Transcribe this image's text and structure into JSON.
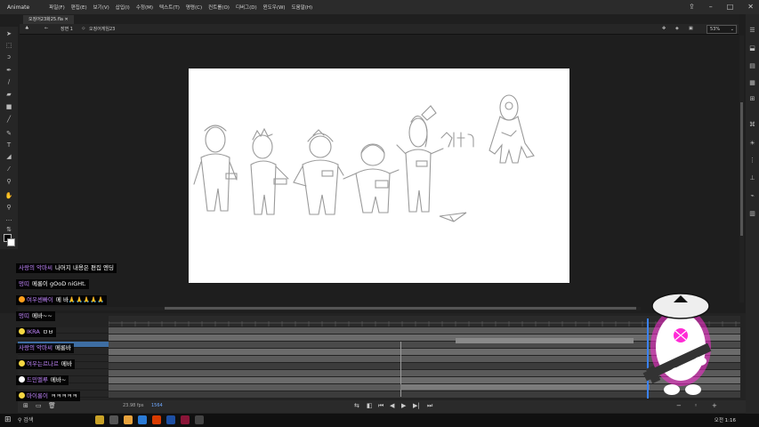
{
  "app": {
    "name": "Animate",
    "menus": [
      "파일(F)",
      "편집(E)",
      "보기(V)",
      "삽입(I)",
      "수정(M)",
      "텍스트(T)",
      "명령(C)",
      "컨트롤(O)",
      "디버그(D)",
      "윈도우(W)",
      "도움말(H)"
    ]
  },
  "document": {
    "tab_label": "오징어23화25.fla",
    "scene_label": "장면 1",
    "symbol_label": "오징어게임23",
    "zoom": "53%"
  },
  "canvas": {
    "doodle_text": "오징어게임"
  },
  "timeline": {
    "fps": "23.98",
    "fps_unit": "fps",
    "current_frame": "1564"
  },
  "chat": [
    {
      "nick": "사랑의 악마씨",
      "msg": "나머지 내용은 편집 엔딩",
      "badge": ""
    },
    {
      "nick": "멍띠",
      "msg": "메롱이 gOoD niGHt.",
      "badge": ""
    },
    {
      "nick": "여우센빠이",
      "msg": "메 바🙏🙏🙏🙏🙏",
      "badge": "#ff9f1c"
    },
    {
      "nick": "멍띠",
      "msg": "메바~~",
      "badge": ""
    },
    {
      "nick": "IKRA",
      "msg": "ㅁㅂ",
      "badge": "#f5d742"
    },
    {
      "nick": "사랑의 악마씨",
      "msg": "메롱바",
      "badge": ""
    },
    {
      "nick": "여우는르나르",
      "msg": "메바",
      "badge": "#f5d742"
    },
    {
      "nick": "드민멜루",
      "msg": "메바~",
      "badge": "#fff"
    },
    {
      "nick": "마이롱이",
      "msg": "ㅋㅋㅋㅋㅋ",
      "badge": "#f5d742"
    }
  ],
  "taskbar": {
    "search_label": "검색",
    "clock": "오전 1:16"
  },
  "colors": {
    "accent": "#3e6ea3",
    "chat_nick": "#c084fc",
    "mascot_glow": "#ff2bd6"
  }
}
